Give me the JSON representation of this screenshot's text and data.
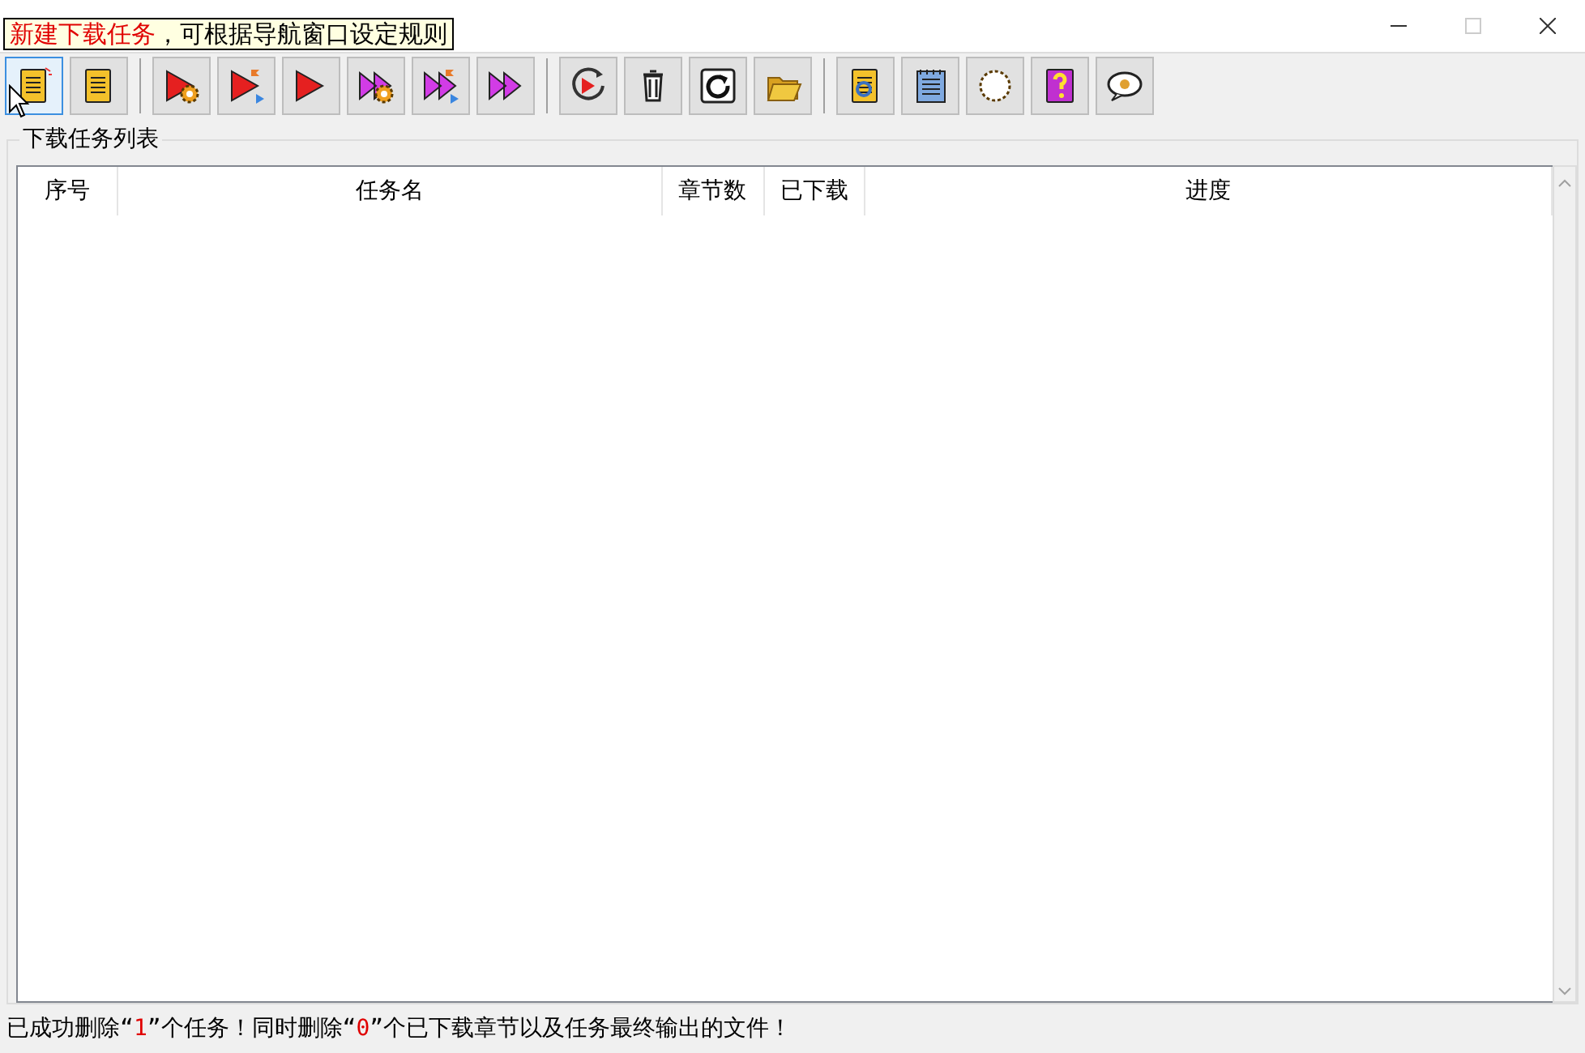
{
  "tooltip": {
    "parts": [
      {
        "text": "新建下载任务",
        "highlight": true
      },
      {
        "text": "，可根据导航窗口设定规则",
        "highlight": false
      }
    ]
  },
  "toolbar": {
    "groups": [
      [
        {
          "kind": "new-task",
          "selected": true
        },
        {
          "kind": "task-list",
          "selected": false
        }
      ],
      [
        {
          "kind": "play-gear",
          "selected": false
        },
        {
          "kind": "play-flag",
          "selected": false
        },
        {
          "kind": "play",
          "selected": false
        },
        {
          "kind": "fast-gear",
          "selected": false
        },
        {
          "kind": "fast-flag",
          "selected": false
        },
        {
          "kind": "fast",
          "selected": false
        }
      ],
      [
        {
          "kind": "replay",
          "selected": false
        },
        {
          "kind": "trash",
          "selected": false
        },
        {
          "kind": "refresh",
          "selected": false
        },
        {
          "kind": "folder",
          "selected": false
        }
      ],
      [
        {
          "kind": "book-ie",
          "selected": false
        },
        {
          "kind": "notepad",
          "selected": false
        },
        {
          "kind": "gear",
          "selected": false
        },
        {
          "kind": "help",
          "selected": false
        },
        {
          "kind": "chat",
          "selected": false
        }
      ]
    ]
  },
  "task_list": {
    "title": "下载任务列表",
    "columns": [
      "序号",
      "任务名",
      "章节数",
      "已下载",
      "进度"
    ]
  },
  "status_bar": {
    "parts": [
      {
        "text": "已成功删除“",
        "highlight": false
      },
      {
        "text": "1",
        "highlight": true
      },
      {
        "text": "”个任务！同时删除“",
        "highlight": false
      },
      {
        "text": "0",
        "highlight": true
      },
      {
        "text": "”个已下载章节以及任务最终输出的文件！",
        "highlight": false
      }
    ]
  }
}
